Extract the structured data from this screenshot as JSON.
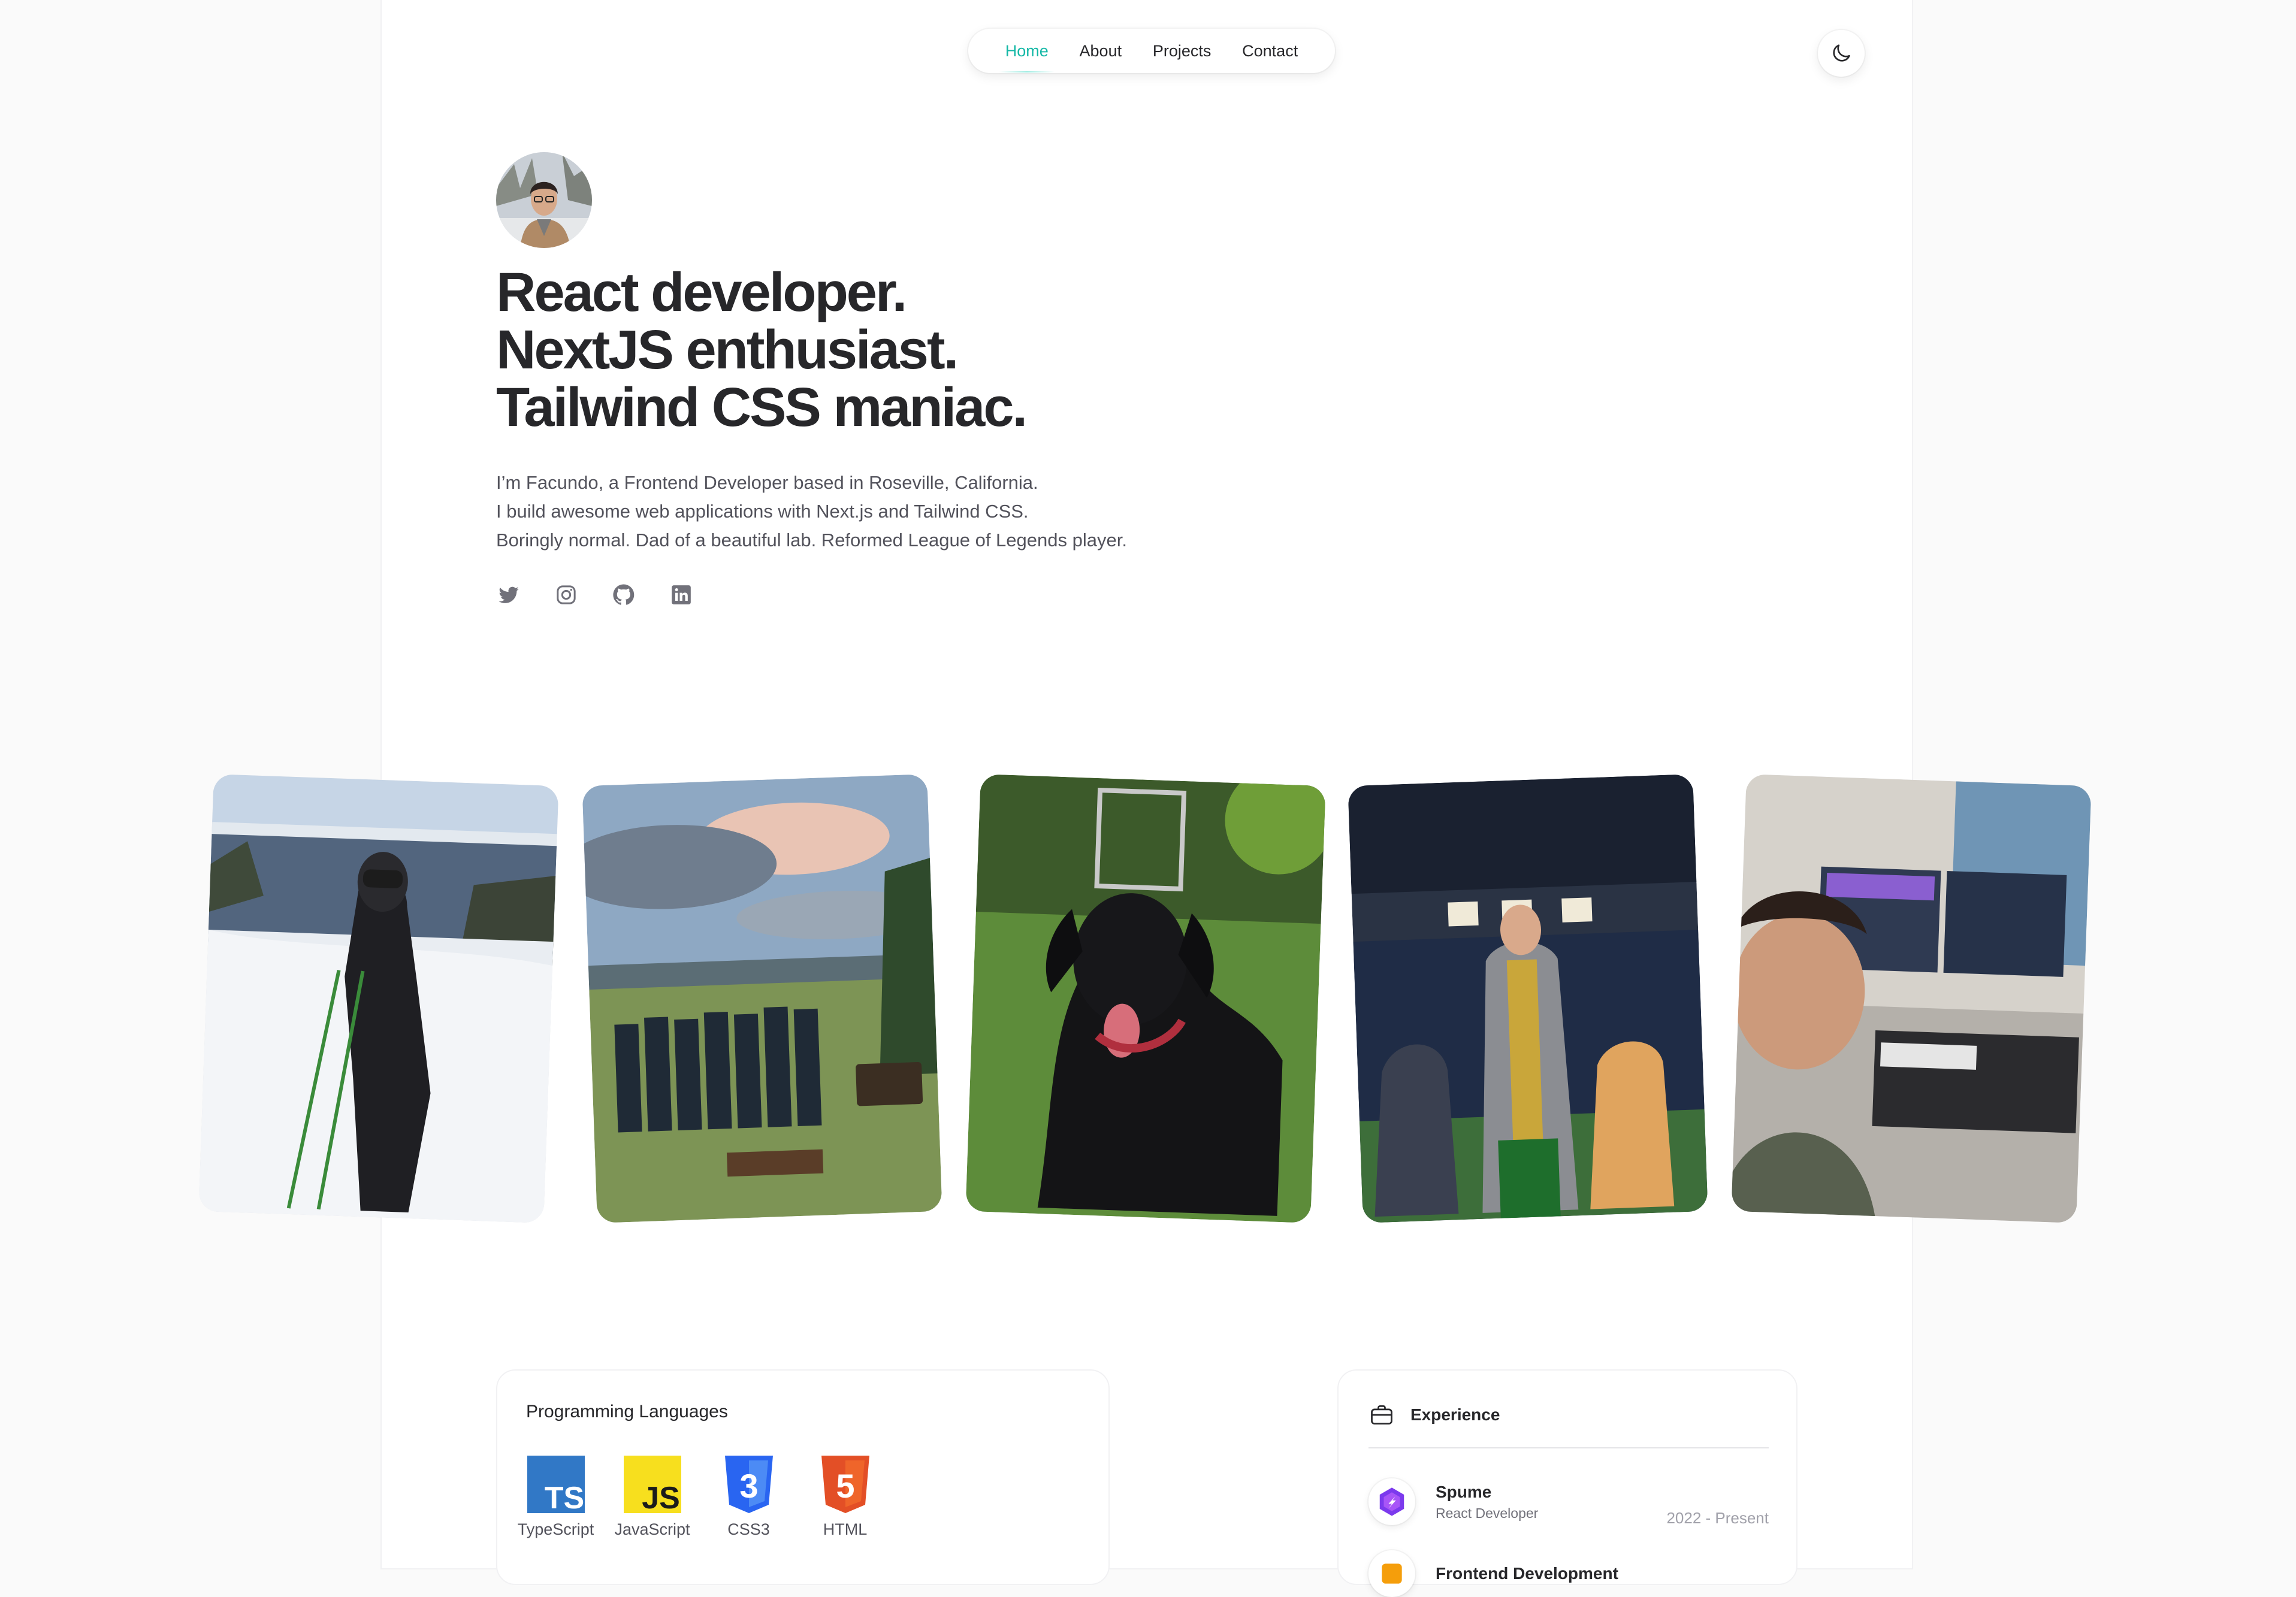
{
  "nav": {
    "items": [
      {
        "label": "Home",
        "active": true
      },
      {
        "label": "About",
        "active": false
      },
      {
        "label": "Projects",
        "active": false
      },
      {
        "label": "Contact",
        "active": false
      }
    ],
    "theme_toggle_icon": "moon-icon"
  },
  "hero": {
    "headline": [
      "React developer.",
      "NextJS enthusiast.",
      "Tailwind CSS maniac."
    ],
    "bio": [
      "I’m Facundo, a Frontend Developer based in Roseville, California.",
      "I build awesome web applications with Next.js and Tailwind CSS.",
      "Boringly normal. Dad of a beautiful lab. Reformed League of Legends player."
    ],
    "socials": [
      "twitter-icon",
      "instagram-icon",
      "github-icon",
      "linkedin-icon"
    ]
  },
  "photos": [
    "skiing-photo",
    "group-patagonia-photo",
    "black-labrador-photo",
    "trophy-photo",
    "desk-setup-photo"
  ],
  "languages": {
    "title": "Programming Languages",
    "items": [
      {
        "label": "TypeScript",
        "badge": "TS",
        "color": "#3178c6"
      },
      {
        "label": "JavaScript",
        "badge": "JS",
        "color": "#f7df1e"
      },
      {
        "label": "CSS3",
        "badge": "3",
        "color": "#2965f1"
      },
      {
        "label": "HTML",
        "badge": "5",
        "color": "#e34f26"
      }
    ]
  },
  "experience": {
    "title": "Experience",
    "jobs": [
      {
        "company": "Spume",
        "role": "React Developer",
        "dates": "2022 - Present"
      },
      {
        "company": "Frontend Development",
        "role": "",
        "dates": ""
      }
    ]
  },
  "colors": {
    "accent": "#14b8a6",
    "text": "#27272a",
    "muted": "#52525b"
  }
}
